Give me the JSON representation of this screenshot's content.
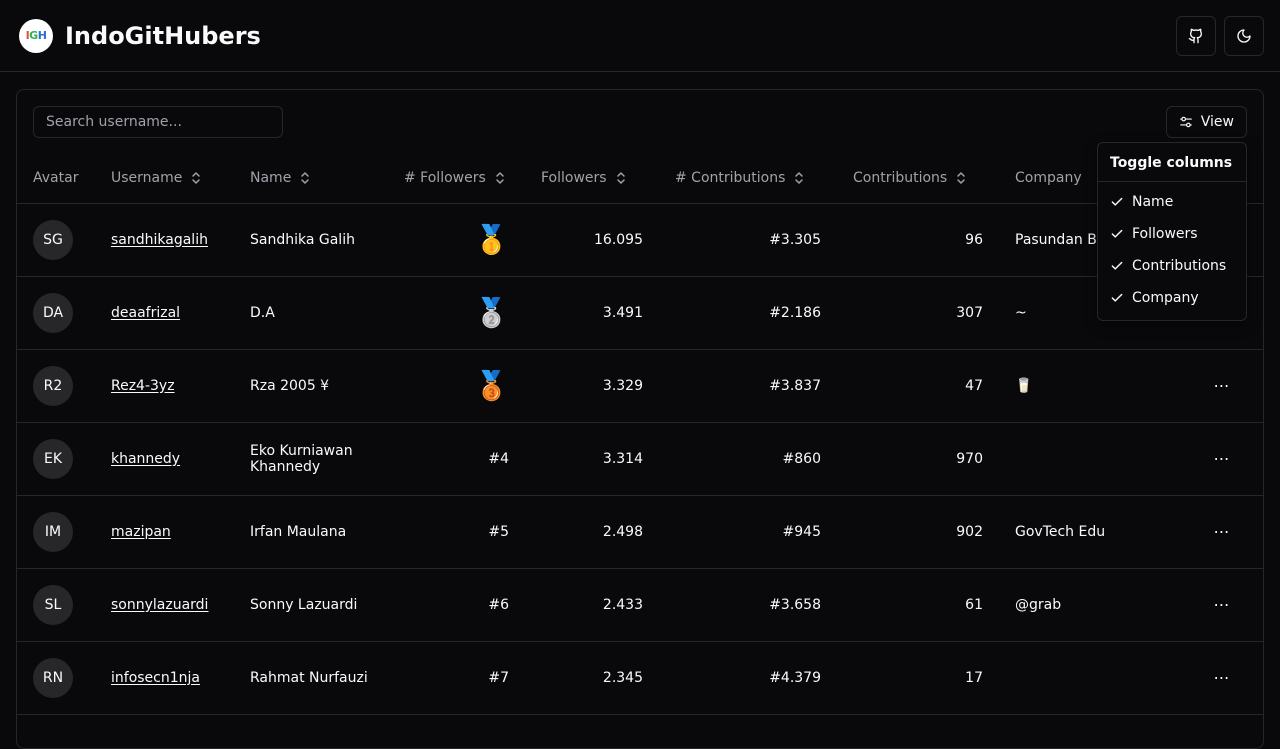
{
  "header": {
    "logo_letters": [
      "I",
      "G",
      "H"
    ],
    "title": "IndoGitHubers",
    "github_icon": "github-icon",
    "theme_icon": "moon-icon"
  },
  "search": {
    "placeholder": "Search username..."
  },
  "view_button": {
    "label": "View",
    "icon": "sliders-icon"
  },
  "columns": {
    "avatar": "Avatar",
    "username": "Username",
    "name": "Name",
    "followers_rank": "# Followers",
    "followers": "Followers",
    "contributions_rank": "# Contributions",
    "contributions": "Contributions",
    "company": "Company"
  },
  "toggle_menu": {
    "title": "Toggle columns",
    "items": [
      {
        "label": "Name",
        "checked": true
      },
      {
        "label": "Followers",
        "checked": true
      },
      {
        "label": "Contributions",
        "checked": true
      },
      {
        "label": "Company",
        "checked": true
      }
    ]
  },
  "rows": [
    {
      "initials": "SG",
      "username": "sandhikagalih",
      "name": "Sandhika Galih",
      "rank": "",
      "medal": "🥇",
      "followers": "16.095",
      "contrib_rank": "#3.305",
      "contributions": "96",
      "company": "Pasundan Bandung"
    },
    {
      "initials": "DA",
      "username": "deaafrizal",
      "name": "D.A",
      "rank": "",
      "medal": "🥈",
      "followers": "3.491",
      "contrib_rank": "#2.186",
      "contributions": "307",
      "company": "~"
    },
    {
      "initials": "R2",
      "username": "Rez4-3yz",
      "name": "Rza 2005 ¥",
      "rank": "",
      "medal": "🥉",
      "followers": "3.329",
      "contrib_rank": "#3.837",
      "contributions": "47",
      "company": "🥛"
    },
    {
      "initials": "EK",
      "username": "khannedy",
      "name": "Eko Kurniawan Khannedy",
      "rank": "#4",
      "medal": "",
      "followers": "3.314",
      "contrib_rank": "#860",
      "contributions": "970",
      "company": ""
    },
    {
      "initials": "IM",
      "username": "mazipan",
      "name": "Irfan Maulana",
      "rank": "#5",
      "medal": "",
      "followers": "2.498",
      "contrib_rank": "#945",
      "contributions": "902",
      "company": "GovTech Edu"
    },
    {
      "initials": "SL",
      "username": "sonnylazuardi",
      "name": "Sonny Lazuardi",
      "rank": "#6",
      "medal": "",
      "followers": "2.433",
      "contrib_rank": "#3.658",
      "contributions": "61",
      "company": "@grab"
    },
    {
      "initials": "RN",
      "username": "infosecn1nja",
      "name": "Rahmat Nurfauzi",
      "rank": "#7",
      "medal": "",
      "followers": "2.345",
      "contrib_rank": "#4.379",
      "contributions": "17",
      "company": ""
    }
  ],
  "row_action": "⋯"
}
